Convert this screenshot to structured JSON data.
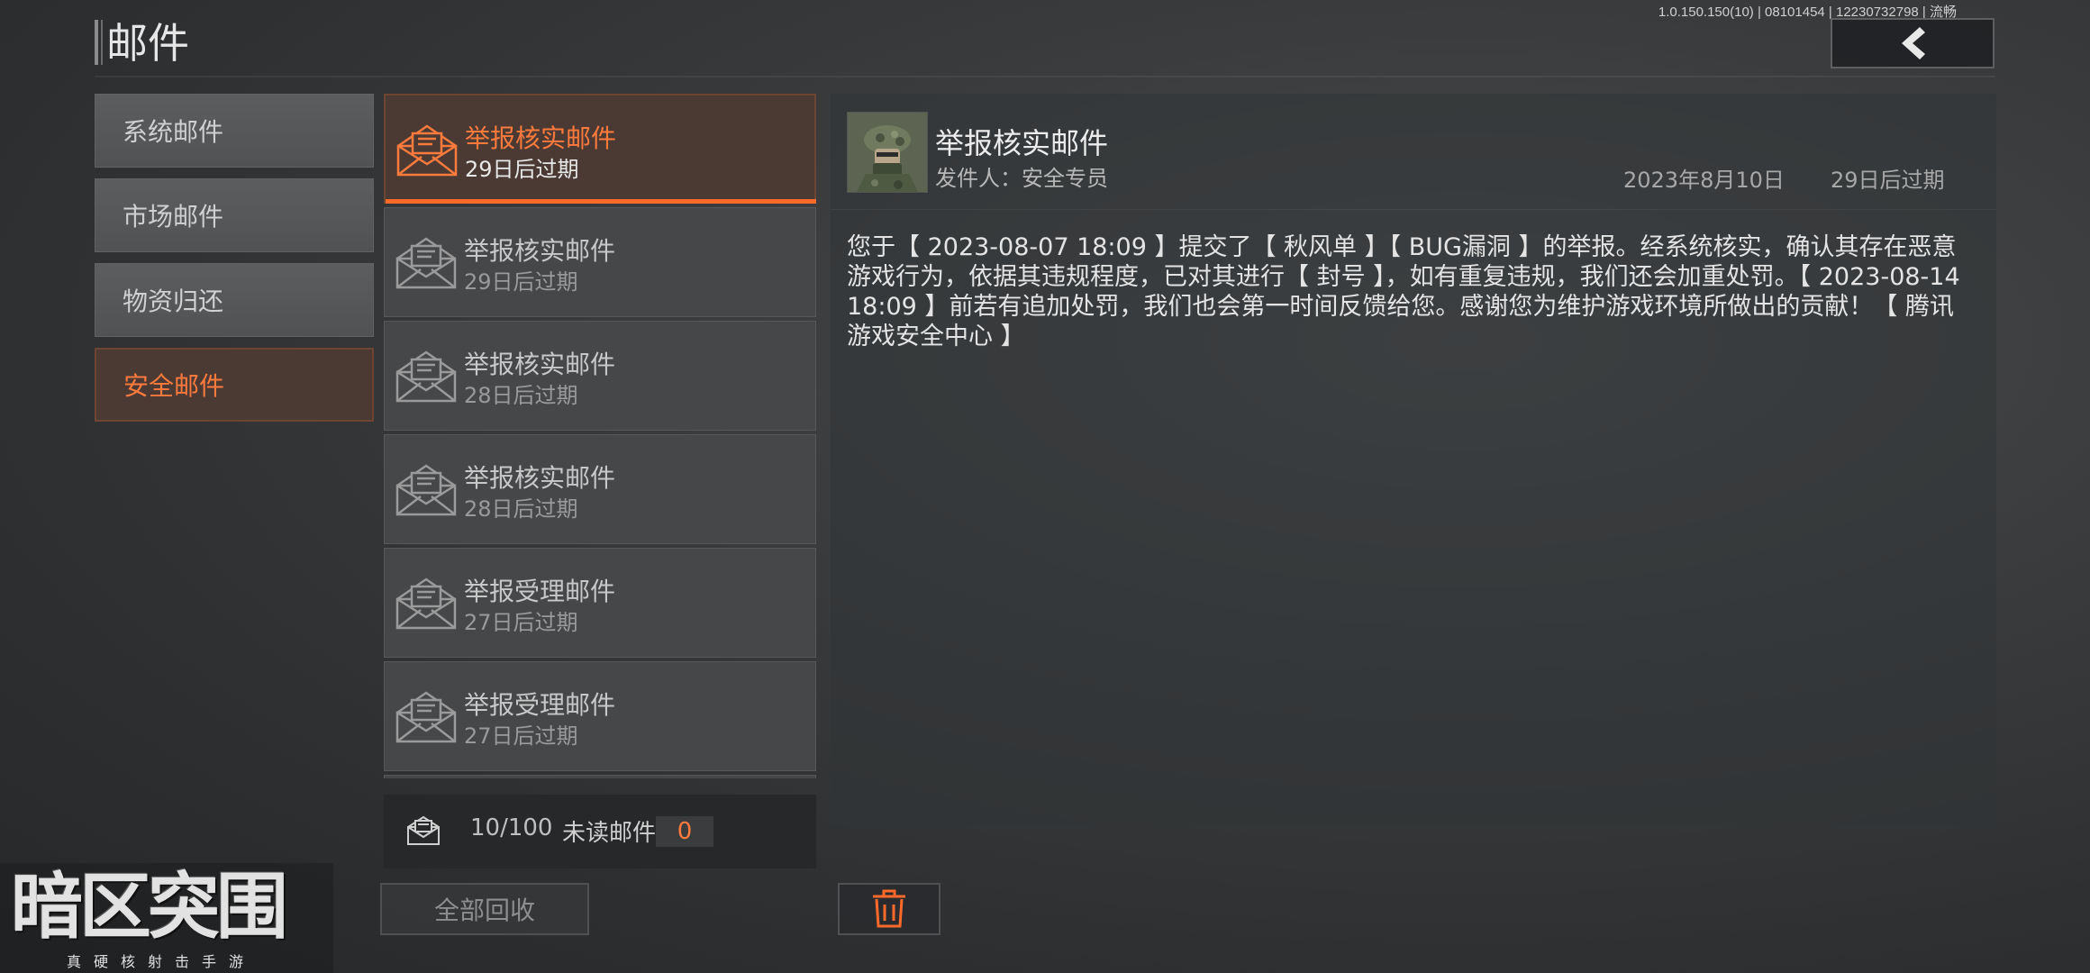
{
  "header": {
    "title": "邮件",
    "version": "1.0.150.150(10) | 08101454 | 12230732798 | 流畅"
  },
  "categories": [
    {
      "label": "系统邮件"
    },
    {
      "label": "市场邮件"
    },
    {
      "label": "物资归还"
    },
    {
      "label": "安全邮件",
      "active": true
    }
  ],
  "mail_list": [
    {
      "title": "举报核实邮件",
      "expire": "29日后过期",
      "selected": true
    },
    {
      "title": "举报核实邮件",
      "expire": "29日后过期"
    },
    {
      "title": "举报核实邮件",
      "expire": "28日后过期"
    },
    {
      "title": "举报核实邮件",
      "expire": "28日后过期"
    },
    {
      "title": "举报受理邮件",
      "expire": "27日后过期"
    },
    {
      "title": "举报受理邮件",
      "expire": "27日后过期"
    }
  ],
  "counter": {
    "count": "10/100",
    "unread_label": "未读邮件",
    "unread": "0"
  },
  "actions": {
    "collect_all": "全部回收"
  },
  "detail": {
    "title": "举报核实邮件",
    "sender": "发件人：安全专员",
    "date": "2023年8月10日",
    "expire": "29日后过期",
    "body": "您于【 2023-08-07 18:09 】提交了【 秋风单 】【 BUG漏洞 】的举报。经系统核实，确认其存在恶意游戏行为，依据其违规程度，已对其进行【 封号 】，如有重复违规，我们还会加重处罚。【 2023-08-14 18:09 】前若有追加处罚，我们也会第一时间反馈给您。感谢您为维护游戏环境所做出的贡献！【 腾讯游戏安全中心 】"
  },
  "logo": {
    "name": "暗区突围",
    "slogan": "真硬核射击手游"
  },
  "colors": {
    "accent": "#ff7a3d",
    "selected_bg": "#4a3a33"
  },
  "icons": {
    "back": "chevron-left-icon",
    "mail": "envelope-open-icon",
    "delete": "trash-icon"
  }
}
